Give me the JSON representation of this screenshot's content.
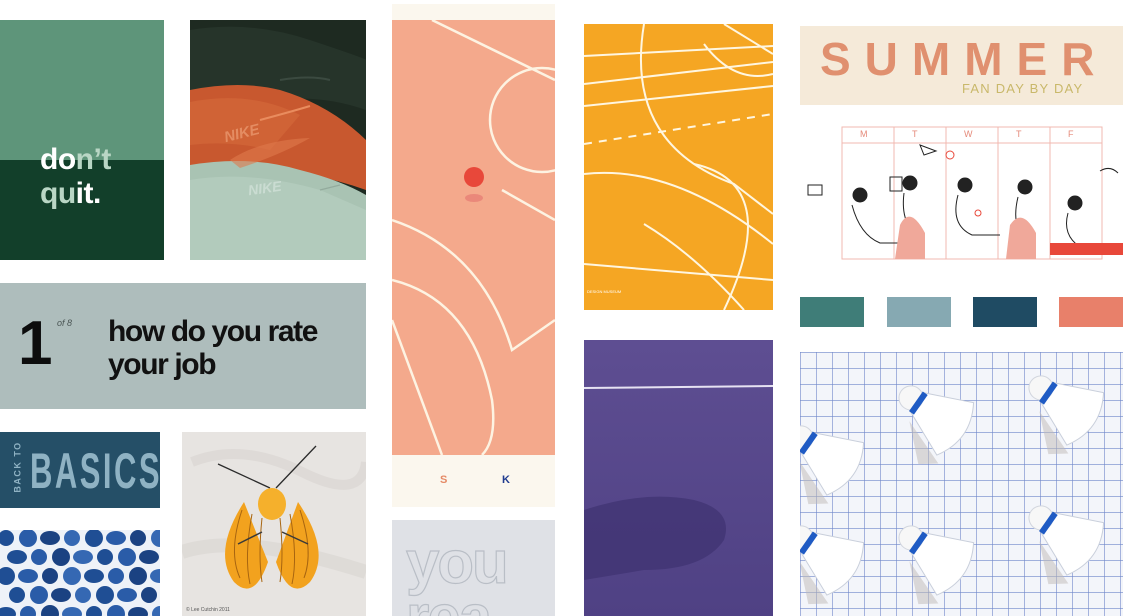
{
  "tiles": {
    "dont_quit": {
      "line1": {
        "a": "do",
        "b": "n’t"
      },
      "line2": {
        "a": "qu",
        "b": "it."
      }
    },
    "rate_job": {
      "number": "1",
      "of_label": "of 8",
      "question_line1": "how do you rate",
      "question_line2": "your job"
    },
    "basics": {
      "small": "BACK TO",
      "big": "BASICS"
    },
    "moth": {
      "credit": "© Lee Cutchin 2011"
    },
    "court": {
      "letter_left": "S",
      "letter_right": "K"
    },
    "you": {
      "line1": "you",
      "line2": "rea"
    },
    "orange_court": {
      "caption": "DESIGN MUSEUM"
    },
    "summer": {
      "title": "SUMMER",
      "subtitle": "FAN DAY BY DAY"
    },
    "calendar": {
      "days": [
        "M",
        "T",
        "W",
        "T",
        "F"
      ]
    },
    "nike": {
      "logo_text": "NIKE"
    }
  },
  "palette": [
    "#3f7d78",
    "#86a9b2",
    "#1f4b63",
    "#e8806a"
  ],
  "colors": {
    "dont_quit_green": "#5e957a",
    "dont_quit_dark": "#123f2a",
    "court_salmon": "#f4a98c",
    "court_orange": "#f5a623",
    "court_purple": "#5b4a8d",
    "basics_blue": "#254f67"
  }
}
